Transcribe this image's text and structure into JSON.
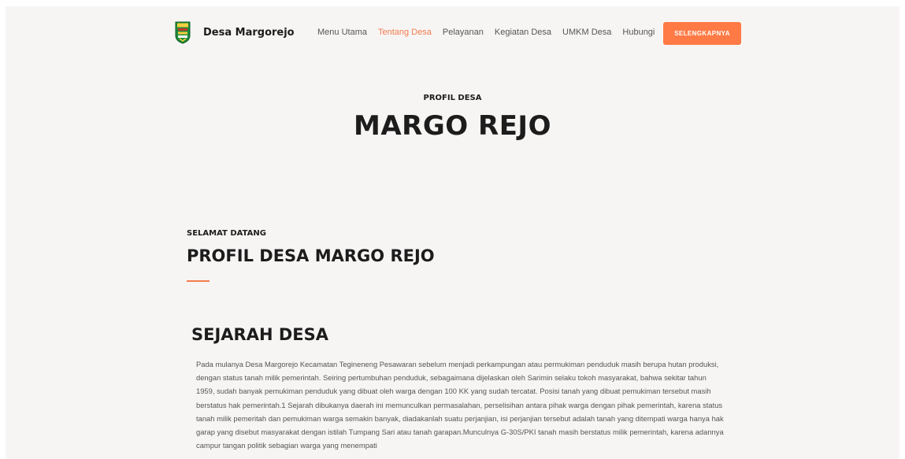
{
  "nav": {
    "brand": "Desa Margorejo",
    "logo_icon": "village-emblem-icon",
    "menu": [
      {
        "label": "Menu Utama",
        "active": false
      },
      {
        "label": "Tentang Desa",
        "active": true
      },
      {
        "label": "Pelayanan",
        "active": false
      },
      {
        "label": "Kegiatan Desa",
        "active": false
      },
      {
        "label": "UMKM Desa",
        "active": false
      },
      {
        "label": "Hubungi",
        "active": false
      }
    ],
    "cta_label": "SELENGKAPNYA"
  },
  "hero": {
    "subtitle": "PROFIL DESA",
    "title": "MARGO REJO"
  },
  "section": {
    "subtitle": "SELAMAT DATANG",
    "title": "PROFIL DESA MARGO REJO"
  },
  "history": {
    "title": "SEJARAH DESA",
    "body": "Pada mulanya Desa Margorejo Kecamatan Tegineneng Pesawaran sebelum menjadi perkampungan atau permukiman penduduk masih berupa hutan produksi, dengan status tanah milik pemerintah. Seiring pertumbuhan penduduk, sebagaimana dijelaskan oleh Sarimin selaku tokoh masyarakat, bahwa sekitar tahun 1959, sudah banyak pemukiman penduduk yang dibuat oleh warga dengan 100 KK yang sudah tercatat. Posisi tanah yang dibuat pemukiman tersebut masih berstatus hak pemerintah.1 Sejarah dibukanya daerah ini memunculkan permasalahan, perselisihan antara pihak warga dengan pihak pemerintah, karena status tanah milik pemeritah dan pemukiman warga semakin banyak, diadakanlah suatu perjanjian, isi perjanjian tersebut adalah tanah yang ditempati warga hanya hak garap yang disebut masyarakat dengan istilah Tumpang Sari atau tanah garapan.Munculnya G-30S/PKI tanah masih berstatus milik pemerintah, karena adannya campur tangan politik sebagian warga yang menempati"
  },
  "colors": {
    "accent": "#ff7a45",
    "background": "#f7f5f4",
    "text": "#1c1c1c"
  }
}
